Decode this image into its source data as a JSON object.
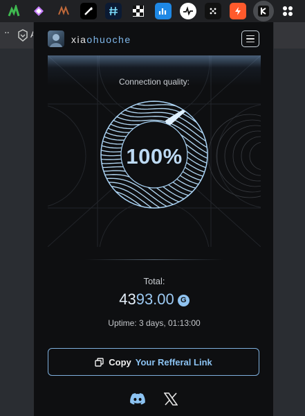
{
  "toolbar": {
    "extensions": [
      {
        "icon": "green-chart-ext-icon",
        "color": "#3fb950"
      },
      {
        "icon": "purple-diamond-ext-icon",
        "color": "#c77dff"
      },
      {
        "icon": "brown-wave-ext-icon",
        "color": "#a0522d"
      },
      {
        "icon": "black-wand-ext-icon",
        "color": "#000000"
      },
      {
        "icon": "hash-ext-icon",
        "color": "#0b1a33"
      },
      {
        "icon": "checker-ext-icon",
        "color": "#ffffff"
      },
      {
        "icon": "blue-chart-ext-icon",
        "color": "#1e88e5"
      },
      {
        "icon": "pulse-ext-icon",
        "color": "#ffffff"
      },
      {
        "icon": "dots-ext-icon",
        "color": "#111111"
      },
      {
        "icon": "orange-bolt-ext-icon",
        "color": "#ff5a2c"
      },
      {
        "icon": "grass-ext-icon",
        "color": "#111111"
      },
      {
        "icon": "puzzle-ext-icon",
        "color": "#ffffff"
      }
    ]
  },
  "bookmarks": {
    "first_letter": "A"
  },
  "header": {
    "username_prefix": "xia",
    "username_highlight": "ohuoche"
  },
  "hero": {
    "label": "Connection quality:",
    "percent": "100%",
    "quality_value": 100
  },
  "total": {
    "label": "Total:",
    "value_lead": "43",
    "value_rest": "93.00",
    "coin_symbol": "G"
  },
  "uptime": "Uptime: 3 days, 01:13:00",
  "referral": {
    "prefix": "Copy",
    "accent": "Your Refferal Link"
  },
  "social": [
    "discord-icon",
    "x-icon"
  ],
  "colors": {
    "accent": "#8cc3f2",
    "background": "#0e0f11"
  }
}
